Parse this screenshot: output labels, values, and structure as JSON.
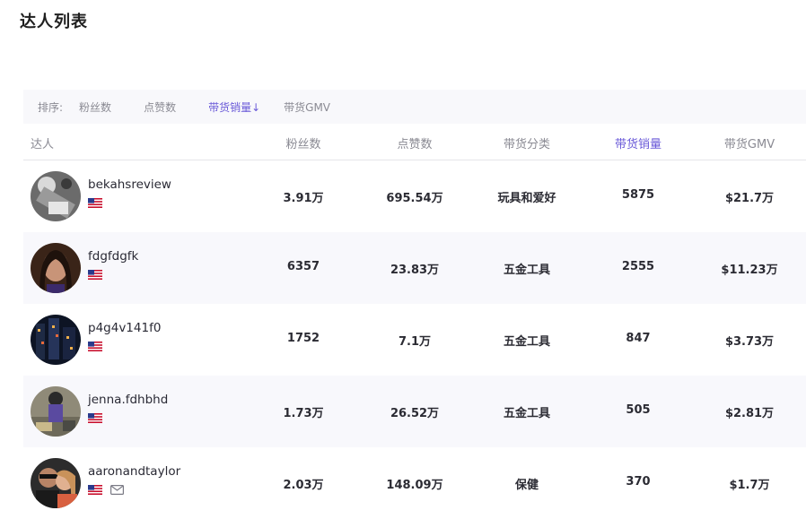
{
  "page": {
    "title": "达人列表"
  },
  "sort": {
    "label": "排序:",
    "options": [
      "粉丝数",
      "点赞数",
      "带货销量↓",
      "带货GMV"
    ],
    "active_index": 2
  },
  "table": {
    "headers": {
      "creator": "达人",
      "followers": "粉丝数",
      "likes": "点赞数",
      "category": "带货分类",
      "sales": "带货销量",
      "gmv": "带货GMV"
    },
    "rows": [
      {
        "name": "bekahsreview",
        "country": "US",
        "followers": "3.91万",
        "likes": "695.54万",
        "category": "玩具和爱好",
        "sales": "5875",
        "gmv": "$21.7万",
        "has_email": false
      },
      {
        "name": "fdgfdgfk",
        "country": "US",
        "followers": "6357",
        "likes": "23.83万",
        "category": "五金工具",
        "sales": "2555",
        "gmv": "$11.23万",
        "has_email": false
      },
      {
        "name": "p4g4v141f0",
        "country": "US",
        "followers": "1752",
        "likes": "7.1万",
        "category": "五金工具",
        "sales": "847",
        "gmv": "$3.73万",
        "has_email": false
      },
      {
        "name": "jenna.fdhbhd",
        "country": "US",
        "followers": "1.73万",
        "likes": "26.52万",
        "category": "五金工具",
        "sales": "505",
        "gmv": "$2.81万",
        "has_email": false
      },
      {
        "name": "aaronandtaylor",
        "country": "US",
        "followers": "2.03万",
        "likes": "148.09万",
        "category": "保健",
        "sales": "370",
        "gmv": "$1.7万",
        "has_email": true
      }
    ]
  },
  "colors": {
    "accent": "#6a5ad8",
    "row_alt_bg": "#f8f8fc",
    "header_text": "#8a8a93"
  },
  "icons": {
    "flag": "us-flag-icon",
    "email": "mail-icon"
  }
}
